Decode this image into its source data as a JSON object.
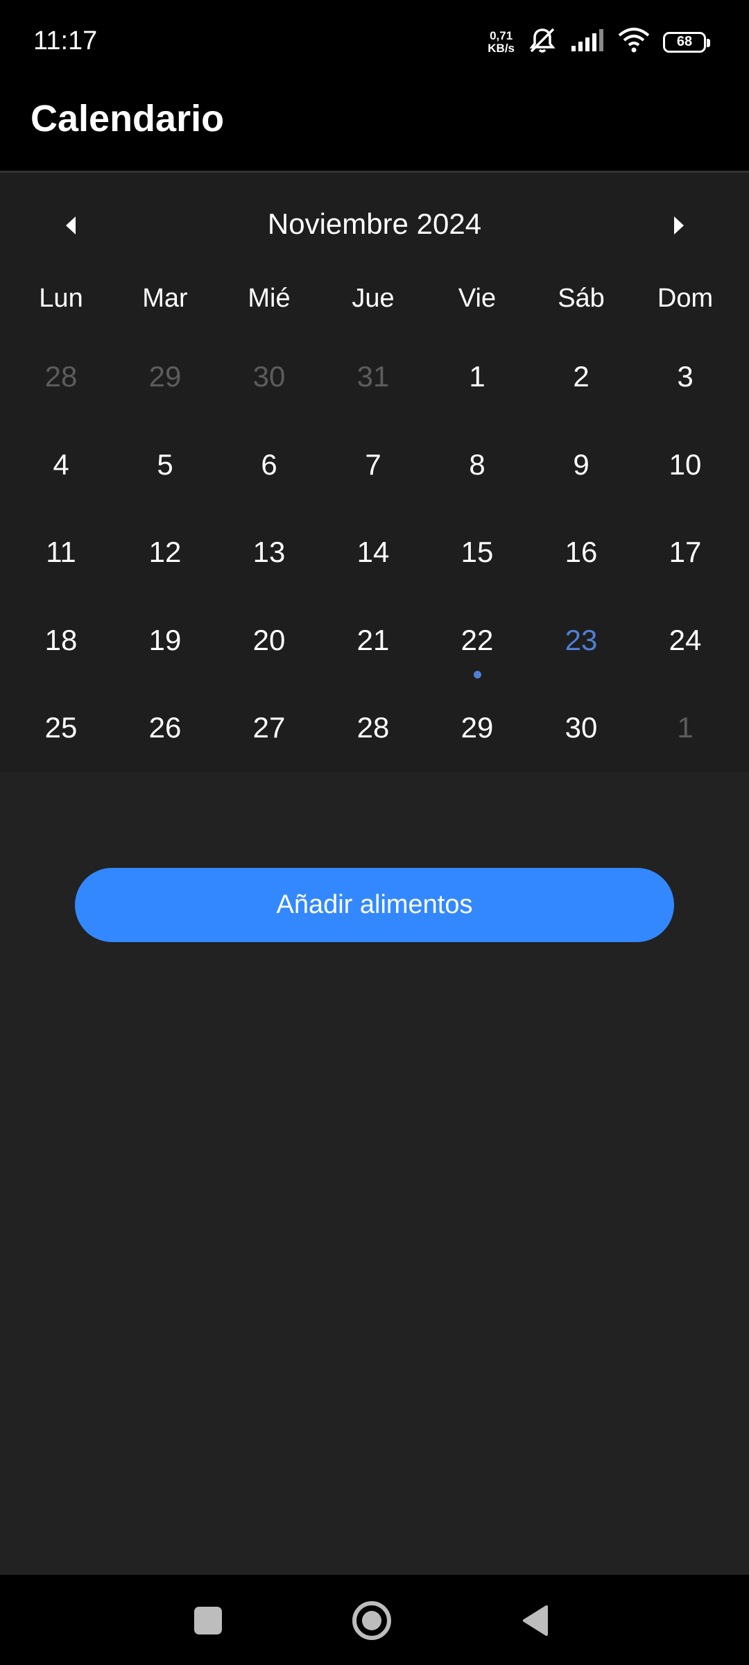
{
  "status_bar": {
    "time": "11:17",
    "net_speed_value": "0,71",
    "net_speed_unit": "KB/s",
    "battery": "68",
    "icons": [
      "mute-icon",
      "signal-icon",
      "wifi-icon",
      "battery-icon"
    ]
  },
  "app_bar": {
    "title": "Calendario"
  },
  "calendar": {
    "month_label": "Noviembre 2024",
    "weekdays": [
      "Lun",
      "Mar",
      "Mié",
      "Jue",
      "Vie",
      "Sáb",
      "Dom"
    ],
    "days": [
      {
        "label": "28",
        "state": "other"
      },
      {
        "label": "29",
        "state": "other"
      },
      {
        "label": "30",
        "state": "other"
      },
      {
        "label": "31",
        "state": "other"
      },
      {
        "label": "1",
        "state": "current"
      },
      {
        "label": "2",
        "state": "current"
      },
      {
        "label": "3",
        "state": "current"
      },
      {
        "label": "4",
        "state": "current"
      },
      {
        "label": "5",
        "state": "current"
      },
      {
        "label": "6",
        "state": "current"
      },
      {
        "label": "7",
        "state": "current"
      },
      {
        "label": "8",
        "state": "current"
      },
      {
        "label": "9",
        "state": "current"
      },
      {
        "label": "10",
        "state": "current"
      },
      {
        "label": "11",
        "state": "current"
      },
      {
        "label": "12",
        "state": "current"
      },
      {
        "label": "13",
        "state": "current"
      },
      {
        "label": "14",
        "state": "current"
      },
      {
        "label": "15",
        "state": "current"
      },
      {
        "label": "16",
        "state": "current"
      },
      {
        "label": "17",
        "state": "current"
      },
      {
        "label": "18",
        "state": "current"
      },
      {
        "label": "19",
        "state": "current"
      },
      {
        "label": "20",
        "state": "current"
      },
      {
        "label": "21",
        "state": "current"
      },
      {
        "label": "22",
        "state": "current",
        "has_event": true
      },
      {
        "label": "23",
        "state": "today"
      },
      {
        "label": "24",
        "state": "current"
      },
      {
        "label": "25",
        "state": "current"
      },
      {
        "label": "26",
        "state": "current"
      },
      {
        "label": "27",
        "state": "current"
      },
      {
        "label": "28",
        "state": "current"
      },
      {
        "label": "29",
        "state": "current"
      },
      {
        "label": "30",
        "state": "current"
      },
      {
        "label": "1",
        "state": "other"
      }
    ],
    "accent_color": "#4f7fd6",
    "other_month_color": "#5c5c5c"
  },
  "add_button": {
    "label": "Añadir alimentos",
    "color": "#3388ff"
  },
  "nav_bar": {
    "icons": [
      "recents-icon",
      "home-icon",
      "back-icon"
    ]
  }
}
